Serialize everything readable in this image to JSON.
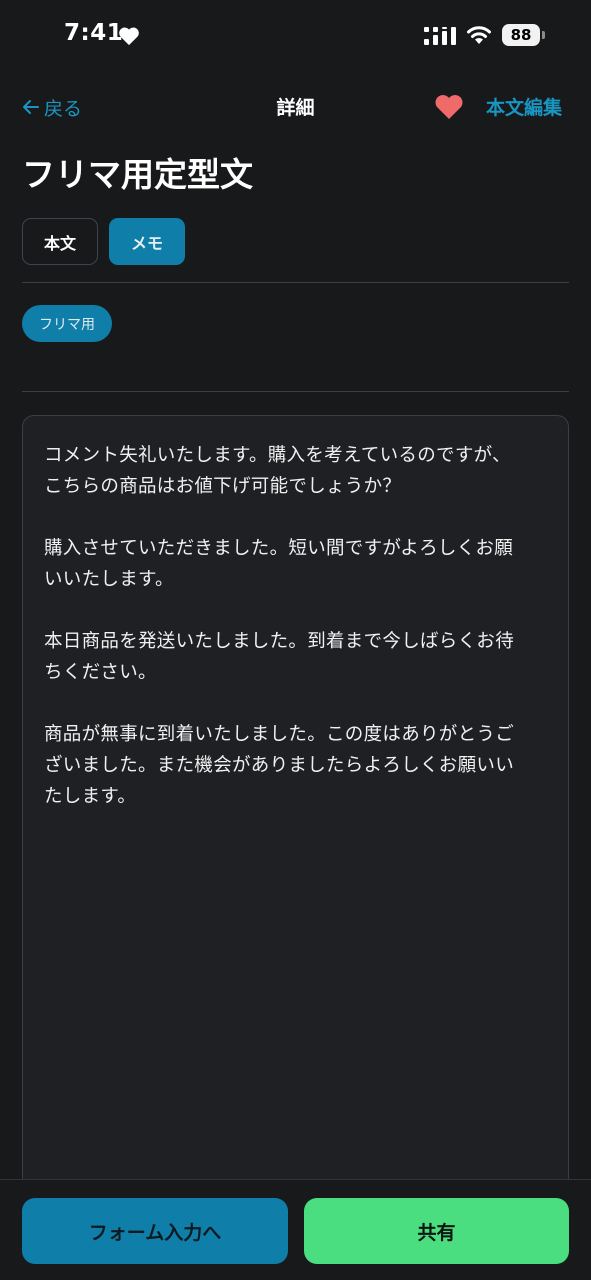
{
  "status_bar": {
    "time": "7:41",
    "battery": "88",
    "icons": [
      "heart-icon",
      "signal-icon",
      "wifi-icon",
      "battery-icon"
    ]
  },
  "nav": {
    "back_label": "戻る",
    "title": "詳細",
    "edit_label": "本文編集",
    "favorite_icon": "heart-icon"
  },
  "page_title": "フリマ用定型文",
  "tabs": [
    {
      "label": "本文",
      "selected": false
    },
    {
      "label": "メモ",
      "selected": true
    }
  ],
  "tag": "フリマ用",
  "memo": {
    "paragraphs": [
      "コメント失礼いたします。購入を考えているのですが、\nこちらの商品はお値下げ可能でしょうか？",
      "購入させていただきました。短い間ですがよろしくお願\nいいたします。",
      "本日商品を発送いたしました。到着まで今しばらくお待\nちください。",
      "商品が無事に到着いたしました。この度はありがとうご\nざいました。また機会がありましたらよろしくお願いい\nたします。"
    ]
  },
  "buttons": {
    "form": "フォーム入力へ",
    "share": "共有"
  },
  "colors": {
    "accent": "#0f7ea8",
    "link": "#1896c1",
    "share": "#4ade80",
    "favorite": "#f06a6a",
    "background": "#18191b"
  }
}
